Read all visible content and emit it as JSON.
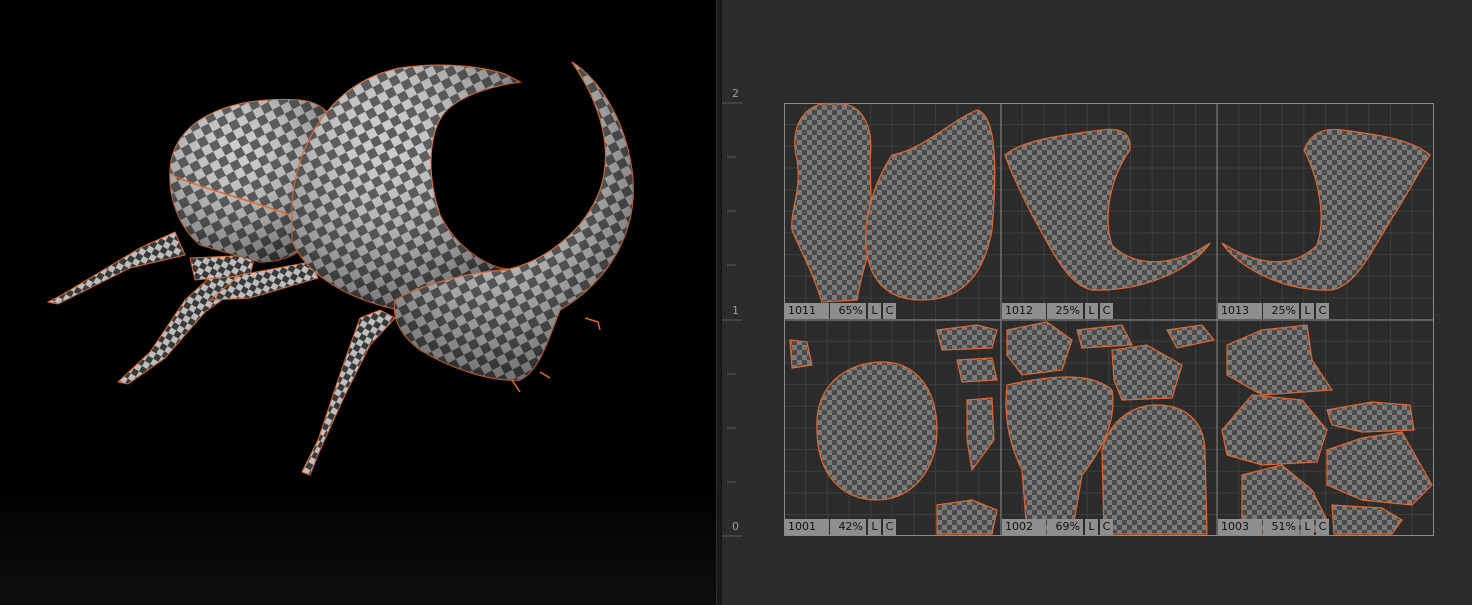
{
  "viewport": {
    "accent_color": "#e0662e",
    "checker_light": "#c6c6c6",
    "checker_dark": "#3c3c3c"
  },
  "uv_editor": {
    "ruler": [
      "2",
      "1",
      "0"
    ],
    "shell_color": "#e0662e",
    "tiles": [
      {
        "udim": "1011",
        "coverage": "65%",
        "lock": "L",
        "center": "C"
      },
      {
        "udim": "1012",
        "coverage": "25%",
        "lock": "L",
        "center": "C"
      },
      {
        "udim": "1013",
        "coverage": "25%",
        "lock": "L",
        "center": "C"
      },
      {
        "udim": "1001",
        "coverage": "42%",
        "lock": "L",
        "center": "C"
      },
      {
        "udim": "1002",
        "coverage": "69%",
        "lock": "L",
        "center": "C"
      },
      {
        "udim": "1003",
        "coverage": "51%",
        "lock": "L",
        "center": "C"
      }
    ]
  }
}
